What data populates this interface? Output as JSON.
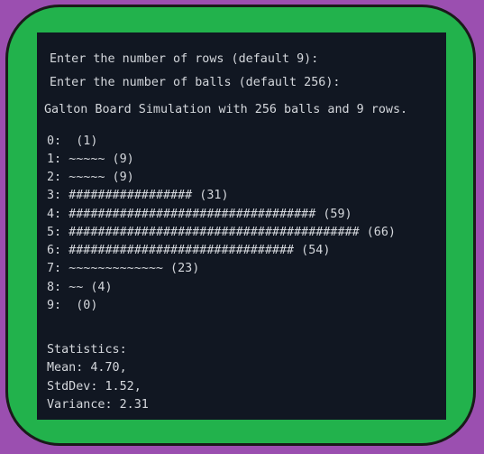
{
  "terminal": {
    "prompts": [
      "Enter the number of rows (default 9):",
      "Enter the number of balls (default 256):"
    ],
    "title": "Galton Board Simulation with 256 balls and 9 rows.",
    "histogram": [
      "0:  (1)",
      "1: ~~~~~ (9)",
      "2: ~~~~~ (9)",
      "3: ################# (31)",
      "4: ################################## (59)",
      "5: ######################################## (66)",
      "6: ############################### (54)",
      "7: ~~~~~~~~~~~~~ (23)",
      "8: ~~ (4)",
      "9:  (0)"
    ],
    "statistics": {
      "header": "Statistics:",
      "mean": "Mean: 4.70,",
      "stddev": "StdDev: 1.52,",
      "variance": "Variance: 2.31"
    }
  },
  "colors": {
    "background": "#9b4fb0",
    "frame": "#22b24c",
    "terminal_bg": "#111722",
    "text": "#d4d7dc"
  }
}
